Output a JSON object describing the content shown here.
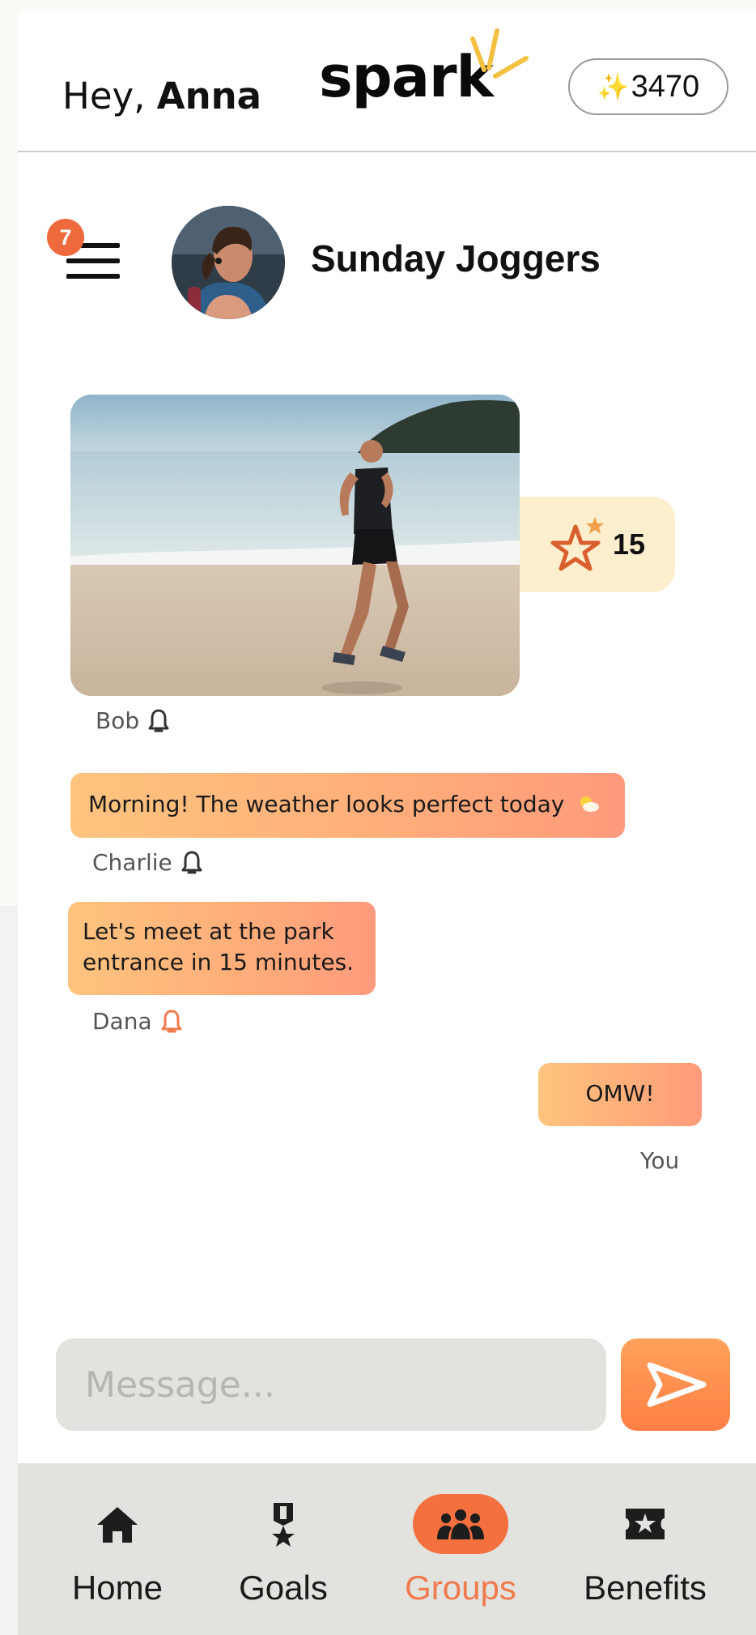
{
  "header": {
    "greeting_prefix": "Hey,",
    "user_name": "Anna",
    "logo": "spark",
    "points": "3470",
    "points_icon": "sparkles-icon"
  },
  "group": {
    "notification_count": "7",
    "name": "Sunday Joggers"
  },
  "messages": [
    {
      "type": "photo",
      "sender": "Bob",
      "reaction_count": "15",
      "reaction_icon": "star-icon"
    },
    {
      "type": "text",
      "sender": "Charlie",
      "text": "Morning! The weather looks perfect today",
      "emoji": "sun-behind-cloud"
    },
    {
      "type": "text",
      "sender": "Dana",
      "text": "Let's meet at the park entrance in 15 minutes."
    },
    {
      "type": "text",
      "sender": "You",
      "text": "OMW!"
    }
  ],
  "composer": {
    "placeholder": "Message..."
  },
  "nav": {
    "items": [
      {
        "label": "Home",
        "icon": "home-icon"
      },
      {
        "label": "Goals",
        "icon": "medal-icon"
      },
      {
        "label": "Groups",
        "icon": "people-icon",
        "active": true
      },
      {
        "label": "Benefits",
        "icon": "ticket-star-icon"
      }
    ]
  },
  "colors": {
    "accent": "#f5703f",
    "bubble_start": "#ffc47e",
    "bubble_end": "#ff9a7c",
    "reaction_bg": "#fdeecd",
    "nav_bg": "#e2e3df"
  }
}
